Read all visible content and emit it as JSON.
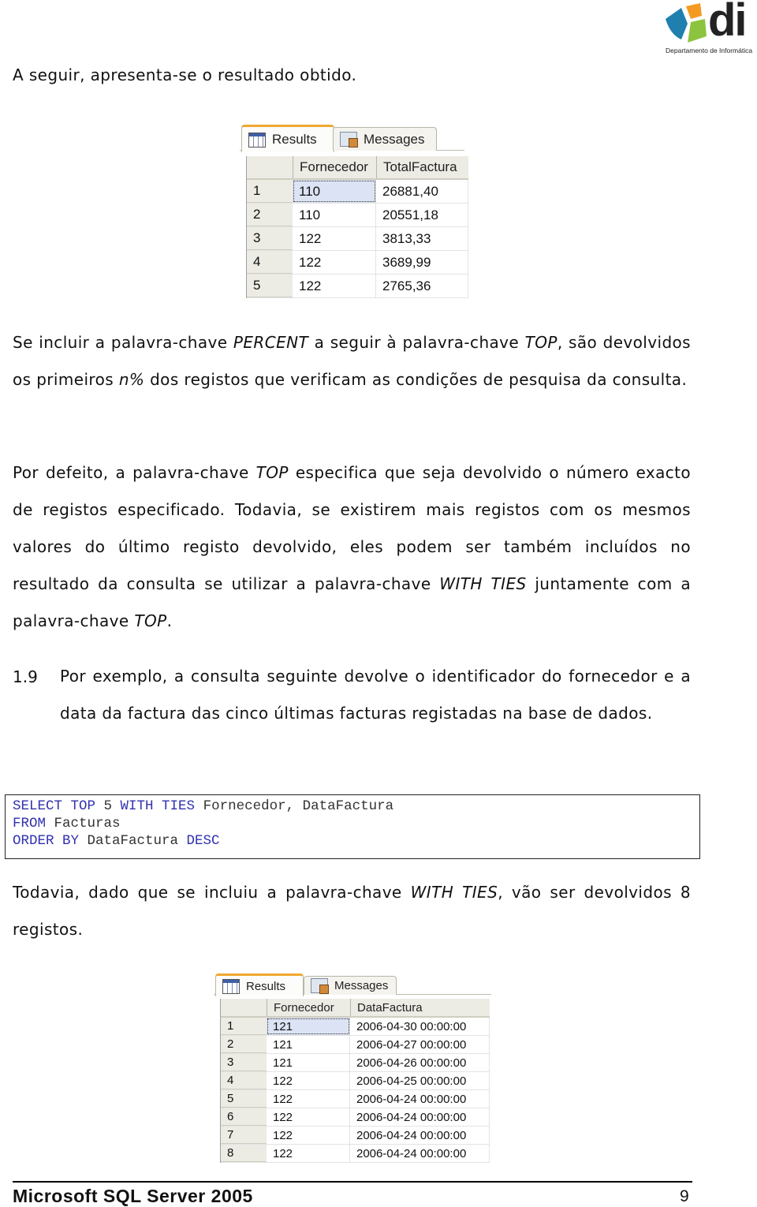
{
  "logo": {
    "text": "di",
    "department": "Departamento de Informática",
    "colors": {
      "blue": "#1f7fae",
      "orange": "#f39a20",
      "green": "#8cc43f"
    }
  },
  "paragraphs": {
    "intro": "A seguir, apresenta-se o resultado obtido.",
    "percent": {
      "parts": [
        "Se incluir a palavra-chave ",
        "PERCENT",
        " a seguir à palavra-chave ",
        "TOP",
        ", são devolvidos os primeiros ",
        "n%",
        " dos registos que verificam as condições de pesquisa da consulta."
      ]
    },
    "ties": {
      "parts": [
        "Por defeito, a palavra-chave ",
        "TOP",
        " especifica que seja devolvido o número exacto de registos especificado. Todavia, se existirem mais registos com os mesmos valores do último registo devolvido, eles podem ser também incluídos no resultado da consulta se utilizar a palavra-chave ",
        "WITH TIES",
        " juntamente com a palavra-chave ",
        "TOP",
        "."
      ]
    },
    "example_number": "1.9",
    "example": "Por exemplo, a consulta seguinte devolve o identificador do fornecedor e a data da factura das cinco últimas facturas registadas na base de dados.",
    "after": {
      "parts": [
        "Todavia, dado que se incluiu a palavra-chave ",
        "WITH TIES",
        ", vão ser devolvidos 8 registos."
      ]
    }
  },
  "code": {
    "lines": [
      [
        {
          "t": "SELECT TOP ",
          "k": true
        },
        {
          "t": "5 ",
          "k": false
        },
        {
          "t": "WITH TIES",
          "k": true
        },
        {
          "t": " Fornecedor, DataFactura",
          "k": false
        }
      ],
      [
        {
          "t": "FROM",
          "k": true
        },
        {
          "t": " Facturas",
          "k": false
        }
      ],
      [
        {
          "t": "ORDER BY",
          "k": true
        },
        {
          "t": " DataFactura ",
          "k": false
        },
        {
          "t": "DESC",
          "k": true
        }
      ]
    ]
  },
  "results1": {
    "tabs": [
      {
        "label": "Results",
        "icon": "grid-icon",
        "active": true
      },
      {
        "label": "Messages",
        "icon": "messages-icon",
        "active": false
      }
    ],
    "columns": [
      "Fornecedor",
      "TotalFactura"
    ],
    "rows": [
      [
        "1",
        "110",
        "26881,40"
      ],
      [
        "2",
        "110",
        "20551,18"
      ],
      [
        "3",
        "122",
        "3813,33"
      ],
      [
        "4",
        "122",
        "3689,99"
      ],
      [
        "5",
        "122",
        "2765,36"
      ]
    ]
  },
  "results2": {
    "tabs": [
      {
        "label": "Results",
        "icon": "grid-icon",
        "active": true
      },
      {
        "label": "Messages",
        "icon": "messages-icon",
        "active": false
      }
    ],
    "columns": [
      "Fornecedor",
      "DataFactura"
    ],
    "rows": [
      [
        "1",
        "121",
        "2006-04-30 00:00:00"
      ],
      [
        "2",
        "121",
        "2006-04-27 00:00:00"
      ],
      [
        "3",
        "121",
        "2006-04-26 00:00:00"
      ],
      [
        "4",
        "122",
        "2006-04-25 00:00:00"
      ],
      [
        "5",
        "122",
        "2006-04-24 00:00:00"
      ],
      [
        "6",
        "122",
        "2006-04-24 00:00:00"
      ],
      [
        "7",
        "122",
        "2006-04-24 00:00:00"
      ],
      [
        "8",
        "122",
        "2006-04-24 00:00:00"
      ]
    ]
  },
  "footer": {
    "title": "Microsoft SQL Server 2005",
    "page": "9"
  }
}
